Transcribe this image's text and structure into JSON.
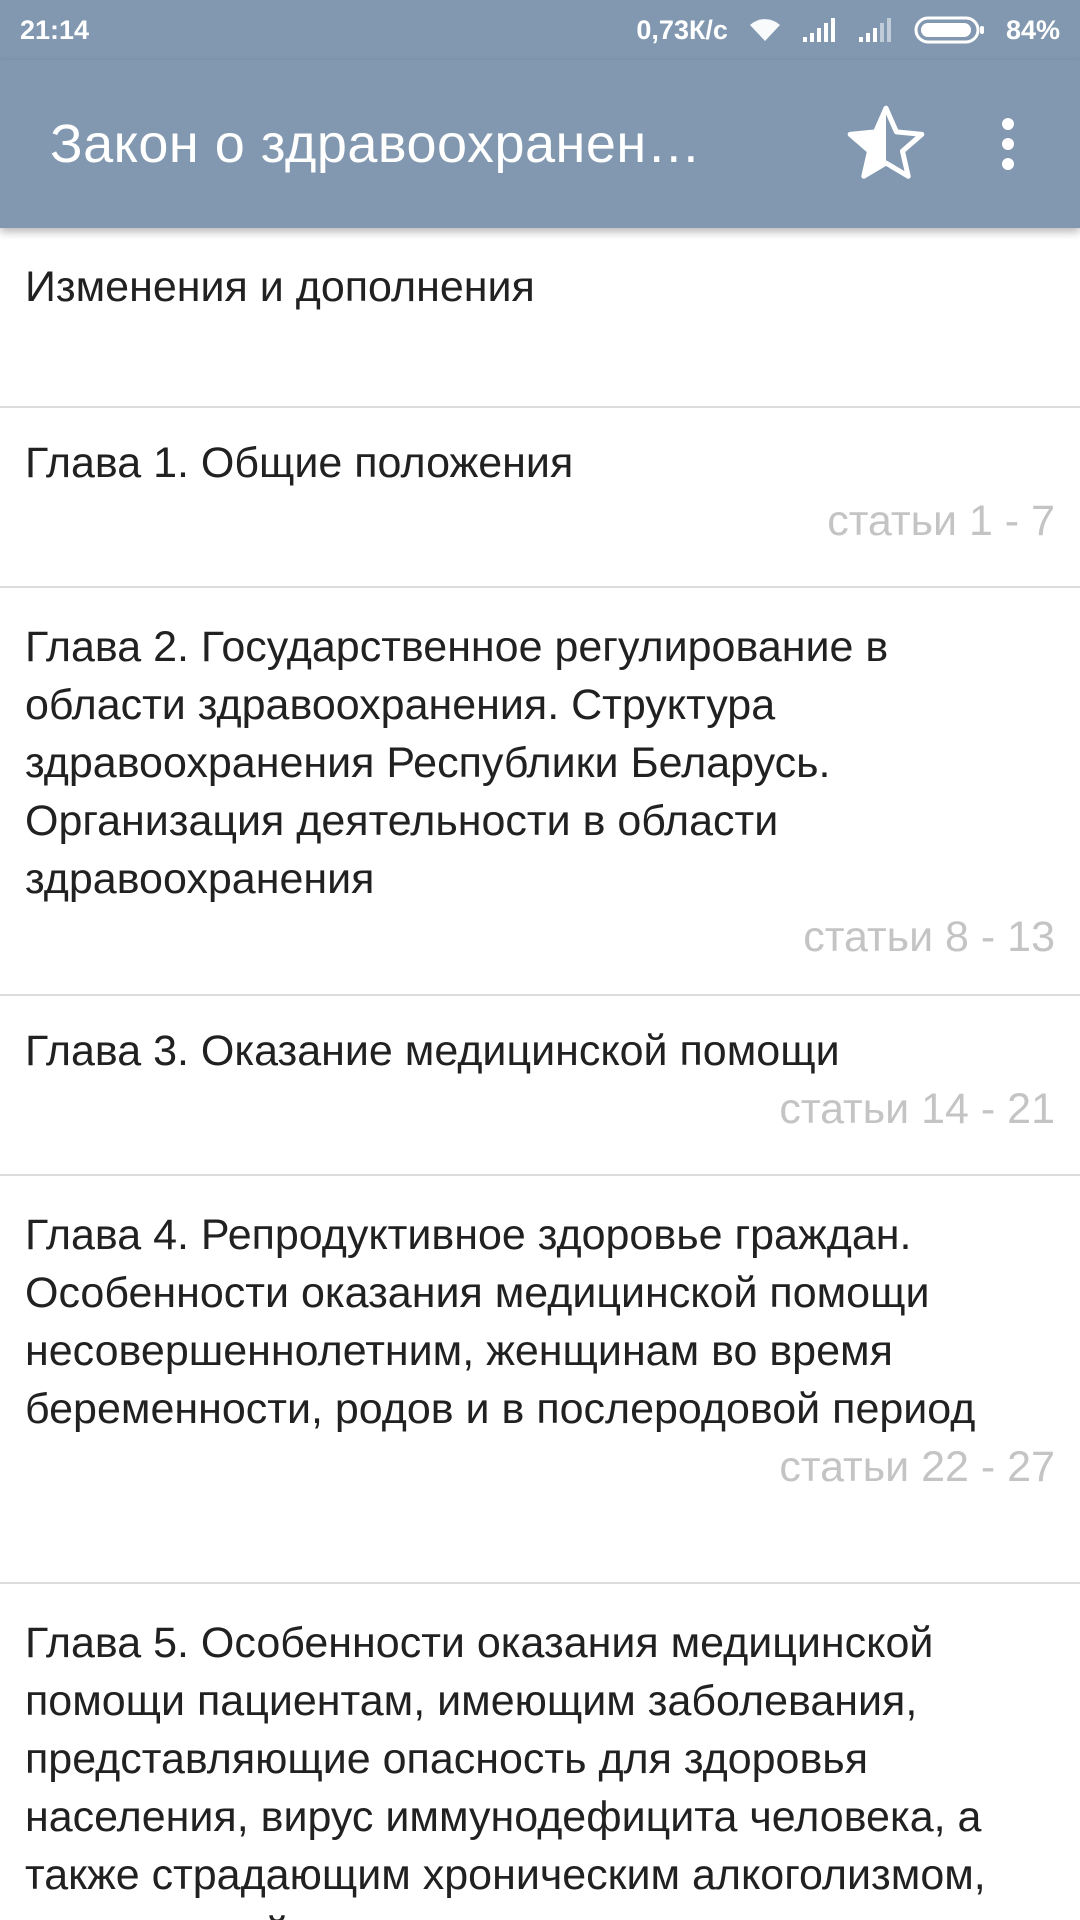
{
  "status_bar": {
    "time": "21:14",
    "network_speed": "0,73К/с",
    "battery": "84%",
    "icons": [
      "wifi-icon",
      "signal-icon",
      "signal-icon",
      "battery-icon"
    ]
  },
  "app_bar": {
    "title": "Закон о здравоохранен…",
    "icons": [
      "star-half-icon",
      "more-vert-icon"
    ]
  },
  "colors": {
    "primary": "#8198b0",
    "divider": "#dcdcdc",
    "muted_text": "#c4c4c4",
    "text": "#212121"
  },
  "chapters": [
    {
      "title": "Изменения и дополнения",
      "range": ""
    },
    {
      "title": "Глава 1. Общие положения",
      "range": "статьи 1 - 7"
    },
    {
      "title": "Глава 2. Государственное регулирование в области здравоохранения. Структура здравоохранения Республики Беларусь. Организация деятельности в области здравоохранения",
      "range": "статьи 8 - 13"
    },
    {
      "title": "Глава 3. Оказание медицинской помощи",
      "range": "статьи 14 - 21"
    },
    {
      "title": "Глава 4. Репродуктивное здоровье граждан. Особенности оказания медицинской помощи несовершеннолетним, женщинам во время беременности, родов и в послеродовой период",
      "range": "статьи 22 - 27"
    },
    {
      "title": "Глава 5. Особенности оказания медицинской помощи пациентам, имеющим заболевания, представляющие опасность для здоровья населения, вирус иммунодефицита человека, а также страдающим хроническим алкоголизмом, наркоманией и",
      "range": ""
    }
  ]
}
